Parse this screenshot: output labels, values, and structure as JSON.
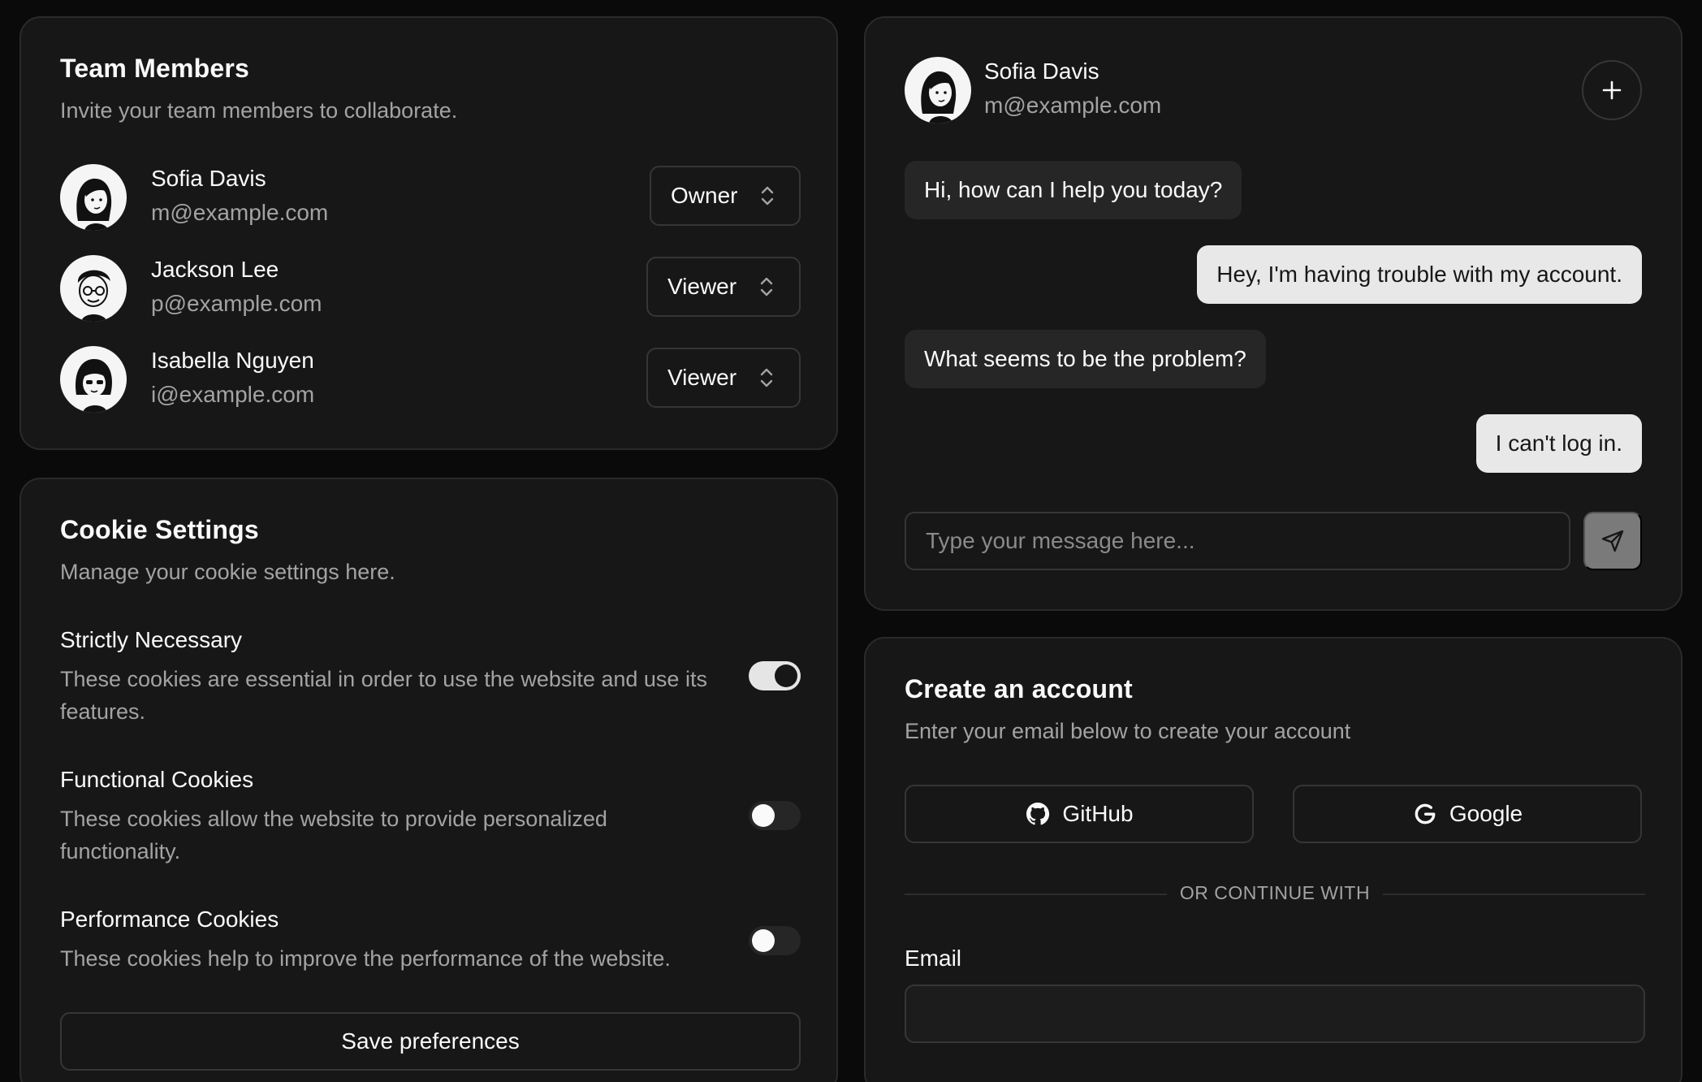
{
  "team": {
    "title": "Team Members",
    "description": "Invite your team members to collaborate.",
    "members": [
      {
        "name": "Sofia Davis",
        "email": "m@example.com",
        "role": "Owner"
      },
      {
        "name": "Jackson Lee",
        "email": "p@example.com",
        "role": "Viewer"
      },
      {
        "name": "Isabella Nguyen",
        "email": "i@example.com",
        "role": "Viewer"
      }
    ]
  },
  "cookies": {
    "title": "Cookie Settings",
    "description": "Manage your cookie settings here.",
    "items": [
      {
        "title": "Strictly Necessary",
        "description": "These cookies are essential in order to use the website and use its features.",
        "enabled": true
      },
      {
        "title": "Functional Cookies",
        "description": "These cookies allow the website to provide personalized functionality.",
        "enabled": false
      },
      {
        "title": "Performance Cookies",
        "description": "These cookies help to improve the performance of the website.",
        "enabled": false
      }
    ],
    "save_label": "Save preferences"
  },
  "chat": {
    "user": {
      "name": "Sofia Davis",
      "email": "m@example.com"
    },
    "messages": [
      {
        "from": "agent",
        "text": "Hi, how can I help you today?"
      },
      {
        "from": "user",
        "text": "Hey, I'm having trouble with my account."
      },
      {
        "from": "agent",
        "text": "What seems to be the problem?"
      },
      {
        "from": "user",
        "text": "I can't log in."
      }
    ],
    "input_placeholder": "Type your message here..."
  },
  "account": {
    "title": "Create an account",
    "description": "Enter your email below to create your account",
    "github_label": "GitHub",
    "google_label": "Google",
    "divider_text": "OR CONTINUE WITH",
    "email_label": "Email",
    "email_value": ""
  },
  "icons": {
    "role_chevron": "chevron-up-down-icon",
    "plus": "plus-icon",
    "send": "send-icon",
    "github": "github-icon",
    "google": "google-icon"
  }
}
